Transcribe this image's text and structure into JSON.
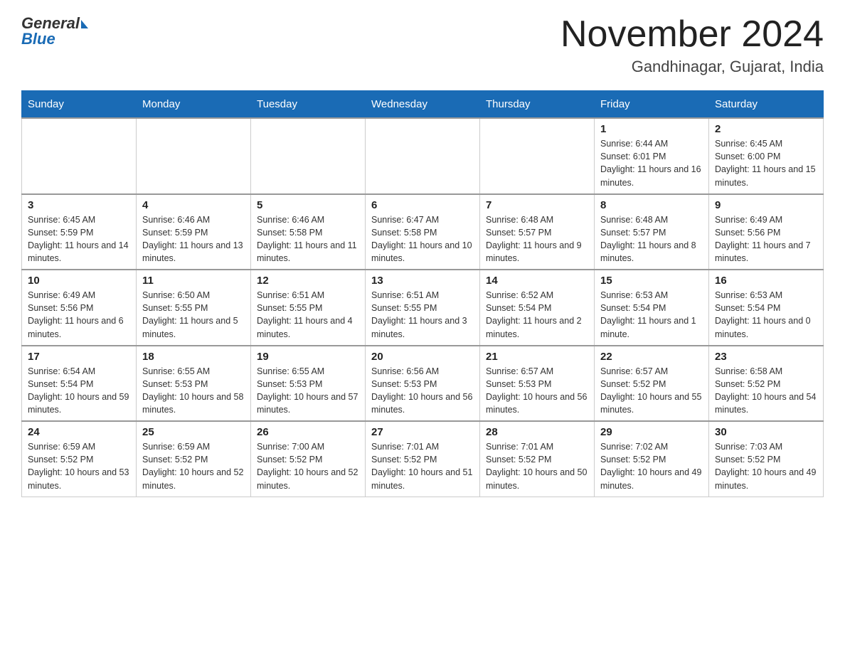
{
  "header": {
    "logo_general": "General",
    "logo_blue": "Blue",
    "month": "November 2024",
    "location": "Gandhinagar, Gujarat, India"
  },
  "weekdays": [
    "Sunday",
    "Monday",
    "Tuesday",
    "Wednesday",
    "Thursday",
    "Friday",
    "Saturday"
  ],
  "weeks": [
    [
      {
        "day": "",
        "info": ""
      },
      {
        "day": "",
        "info": ""
      },
      {
        "day": "",
        "info": ""
      },
      {
        "day": "",
        "info": ""
      },
      {
        "day": "",
        "info": ""
      },
      {
        "day": "1",
        "info": "Sunrise: 6:44 AM\nSunset: 6:01 PM\nDaylight: 11 hours and 16 minutes."
      },
      {
        "day": "2",
        "info": "Sunrise: 6:45 AM\nSunset: 6:00 PM\nDaylight: 11 hours and 15 minutes."
      }
    ],
    [
      {
        "day": "3",
        "info": "Sunrise: 6:45 AM\nSunset: 5:59 PM\nDaylight: 11 hours and 14 minutes."
      },
      {
        "day": "4",
        "info": "Sunrise: 6:46 AM\nSunset: 5:59 PM\nDaylight: 11 hours and 13 minutes."
      },
      {
        "day": "5",
        "info": "Sunrise: 6:46 AM\nSunset: 5:58 PM\nDaylight: 11 hours and 11 minutes."
      },
      {
        "day": "6",
        "info": "Sunrise: 6:47 AM\nSunset: 5:58 PM\nDaylight: 11 hours and 10 minutes."
      },
      {
        "day": "7",
        "info": "Sunrise: 6:48 AM\nSunset: 5:57 PM\nDaylight: 11 hours and 9 minutes."
      },
      {
        "day": "8",
        "info": "Sunrise: 6:48 AM\nSunset: 5:57 PM\nDaylight: 11 hours and 8 minutes."
      },
      {
        "day": "9",
        "info": "Sunrise: 6:49 AM\nSunset: 5:56 PM\nDaylight: 11 hours and 7 minutes."
      }
    ],
    [
      {
        "day": "10",
        "info": "Sunrise: 6:49 AM\nSunset: 5:56 PM\nDaylight: 11 hours and 6 minutes."
      },
      {
        "day": "11",
        "info": "Sunrise: 6:50 AM\nSunset: 5:55 PM\nDaylight: 11 hours and 5 minutes."
      },
      {
        "day": "12",
        "info": "Sunrise: 6:51 AM\nSunset: 5:55 PM\nDaylight: 11 hours and 4 minutes."
      },
      {
        "day": "13",
        "info": "Sunrise: 6:51 AM\nSunset: 5:55 PM\nDaylight: 11 hours and 3 minutes."
      },
      {
        "day": "14",
        "info": "Sunrise: 6:52 AM\nSunset: 5:54 PM\nDaylight: 11 hours and 2 minutes."
      },
      {
        "day": "15",
        "info": "Sunrise: 6:53 AM\nSunset: 5:54 PM\nDaylight: 11 hours and 1 minute."
      },
      {
        "day": "16",
        "info": "Sunrise: 6:53 AM\nSunset: 5:54 PM\nDaylight: 11 hours and 0 minutes."
      }
    ],
    [
      {
        "day": "17",
        "info": "Sunrise: 6:54 AM\nSunset: 5:54 PM\nDaylight: 10 hours and 59 minutes."
      },
      {
        "day": "18",
        "info": "Sunrise: 6:55 AM\nSunset: 5:53 PM\nDaylight: 10 hours and 58 minutes."
      },
      {
        "day": "19",
        "info": "Sunrise: 6:55 AM\nSunset: 5:53 PM\nDaylight: 10 hours and 57 minutes."
      },
      {
        "day": "20",
        "info": "Sunrise: 6:56 AM\nSunset: 5:53 PM\nDaylight: 10 hours and 56 minutes."
      },
      {
        "day": "21",
        "info": "Sunrise: 6:57 AM\nSunset: 5:53 PM\nDaylight: 10 hours and 56 minutes."
      },
      {
        "day": "22",
        "info": "Sunrise: 6:57 AM\nSunset: 5:52 PM\nDaylight: 10 hours and 55 minutes."
      },
      {
        "day": "23",
        "info": "Sunrise: 6:58 AM\nSunset: 5:52 PM\nDaylight: 10 hours and 54 minutes."
      }
    ],
    [
      {
        "day": "24",
        "info": "Sunrise: 6:59 AM\nSunset: 5:52 PM\nDaylight: 10 hours and 53 minutes."
      },
      {
        "day": "25",
        "info": "Sunrise: 6:59 AM\nSunset: 5:52 PM\nDaylight: 10 hours and 52 minutes."
      },
      {
        "day": "26",
        "info": "Sunrise: 7:00 AM\nSunset: 5:52 PM\nDaylight: 10 hours and 52 minutes."
      },
      {
        "day": "27",
        "info": "Sunrise: 7:01 AM\nSunset: 5:52 PM\nDaylight: 10 hours and 51 minutes."
      },
      {
        "day": "28",
        "info": "Sunrise: 7:01 AM\nSunset: 5:52 PM\nDaylight: 10 hours and 50 minutes."
      },
      {
        "day": "29",
        "info": "Sunrise: 7:02 AM\nSunset: 5:52 PM\nDaylight: 10 hours and 49 minutes."
      },
      {
        "day": "30",
        "info": "Sunrise: 7:03 AM\nSunset: 5:52 PM\nDaylight: 10 hours and 49 minutes."
      }
    ]
  ]
}
